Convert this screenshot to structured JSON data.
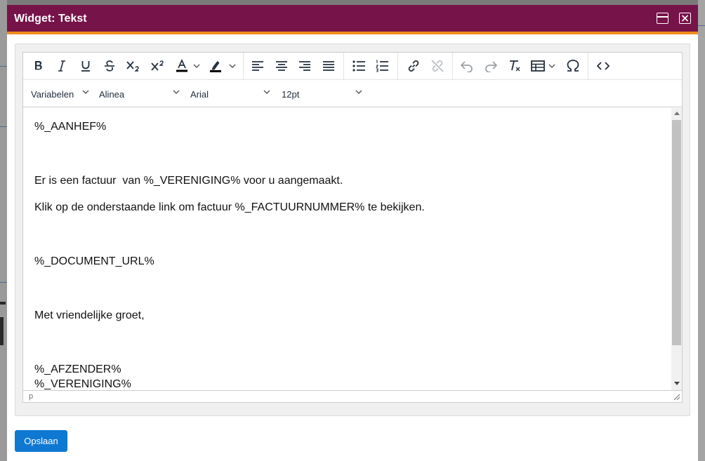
{
  "dialog": {
    "title": "Widget: Tekst",
    "colors": {
      "titlebar": "#761349",
      "accent": "#f28c1a",
      "primary_button": "#0f78d2"
    }
  },
  "toolbar": {
    "buttons": [
      "bold-icon",
      "italic-icon",
      "underline-icon",
      "strikethrough-icon",
      "subscript-icon",
      "superscript-icon",
      "text-color-icon",
      "highlight-color-icon",
      "align-left-icon",
      "align-center-icon",
      "align-right-icon",
      "align-justify-icon",
      "bullet-list-icon",
      "numbered-list-icon",
      "link-icon",
      "unlink-icon",
      "undo-icon",
      "redo-icon",
      "clear-formatting-icon",
      "table-icon",
      "special-character-icon",
      "source-code-icon"
    ],
    "variables_label": "Variabelen",
    "block_format": "Alinea",
    "font_family": "Arial",
    "font_size": "12pt"
  },
  "content": {
    "lines": [
      "%_AANHEF%",
      "Er is een factuur  van %_VERENIGING% voor u aangemaakt.",
      "Klik op de onderstaande link om factuur %_FACTUURNUMMER% te bekijken.",
      "%_DOCUMENT_URL%",
      "Met vriendelijke groet,",
      "%_AFZENDER%",
      "%_VERENIGING%"
    ]
  },
  "statusbar": {
    "path": "p"
  },
  "footer": {
    "save_label": "Opslaan"
  }
}
